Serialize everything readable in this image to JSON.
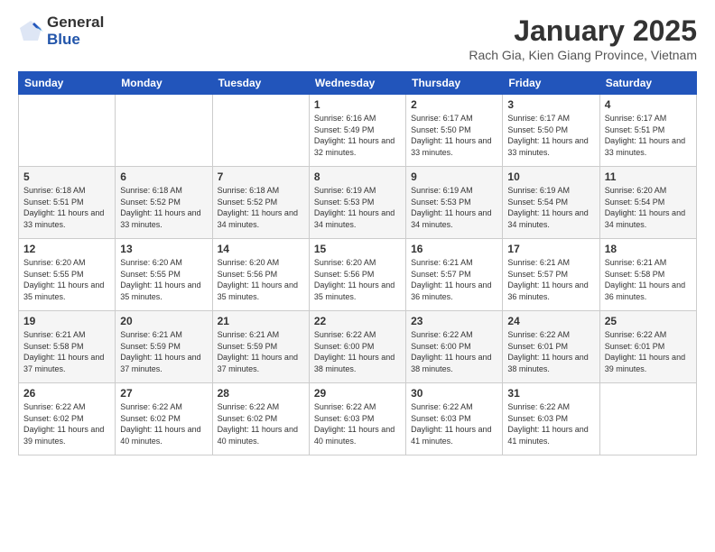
{
  "logo": {
    "general": "General",
    "blue": "Blue"
  },
  "header": {
    "month": "January 2025",
    "location": "Rach Gia, Kien Giang Province, Vietnam"
  },
  "days_of_week": [
    "Sunday",
    "Monday",
    "Tuesday",
    "Wednesday",
    "Thursday",
    "Friday",
    "Saturday"
  ],
  "weeks": [
    [
      {
        "day": "",
        "info": ""
      },
      {
        "day": "",
        "info": ""
      },
      {
        "day": "",
        "info": ""
      },
      {
        "day": "1",
        "info": "Sunrise: 6:16 AM\nSunset: 5:49 PM\nDaylight: 11 hours and 32 minutes."
      },
      {
        "day": "2",
        "info": "Sunrise: 6:17 AM\nSunset: 5:50 PM\nDaylight: 11 hours and 33 minutes."
      },
      {
        "day": "3",
        "info": "Sunrise: 6:17 AM\nSunset: 5:50 PM\nDaylight: 11 hours and 33 minutes."
      },
      {
        "day": "4",
        "info": "Sunrise: 6:17 AM\nSunset: 5:51 PM\nDaylight: 11 hours and 33 minutes."
      }
    ],
    [
      {
        "day": "5",
        "info": "Sunrise: 6:18 AM\nSunset: 5:51 PM\nDaylight: 11 hours and 33 minutes."
      },
      {
        "day": "6",
        "info": "Sunrise: 6:18 AM\nSunset: 5:52 PM\nDaylight: 11 hours and 33 minutes."
      },
      {
        "day": "7",
        "info": "Sunrise: 6:18 AM\nSunset: 5:52 PM\nDaylight: 11 hours and 34 minutes."
      },
      {
        "day": "8",
        "info": "Sunrise: 6:19 AM\nSunset: 5:53 PM\nDaylight: 11 hours and 34 minutes."
      },
      {
        "day": "9",
        "info": "Sunrise: 6:19 AM\nSunset: 5:53 PM\nDaylight: 11 hours and 34 minutes."
      },
      {
        "day": "10",
        "info": "Sunrise: 6:19 AM\nSunset: 5:54 PM\nDaylight: 11 hours and 34 minutes."
      },
      {
        "day": "11",
        "info": "Sunrise: 6:20 AM\nSunset: 5:54 PM\nDaylight: 11 hours and 34 minutes."
      }
    ],
    [
      {
        "day": "12",
        "info": "Sunrise: 6:20 AM\nSunset: 5:55 PM\nDaylight: 11 hours and 35 minutes."
      },
      {
        "day": "13",
        "info": "Sunrise: 6:20 AM\nSunset: 5:55 PM\nDaylight: 11 hours and 35 minutes."
      },
      {
        "day": "14",
        "info": "Sunrise: 6:20 AM\nSunset: 5:56 PM\nDaylight: 11 hours and 35 minutes."
      },
      {
        "day": "15",
        "info": "Sunrise: 6:20 AM\nSunset: 5:56 PM\nDaylight: 11 hours and 35 minutes."
      },
      {
        "day": "16",
        "info": "Sunrise: 6:21 AM\nSunset: 5:57 PM\nDaylight: 11 hours and 36 minutes."
      },
      {
        "day": "17",
        "info": "Sunrise: 6:21 AM\nSunset: 5:57 PM\nDaylight: 11 hours and 36 minutes."
      },
      {
        "day": "18",
        "info": "Sunrise: 6:21 AM\nSunset: 5:58 PM\nDaylight: 11 hours and 36 minutes."
      }
    ],
    [
      {
        "day": "19",
        "info": "Sunrise: 6:21 AM\nSunset: 5:58 PM\nDaylight: 11 hours and 37 minutes."
      },
      {
        "day": "20",
        "info": "Sunrise: 6:21 AM\nSunset: 5:59 PM\nDaylight: 11 hours and 37 minutes."
      },
      {
        "day": "21",
        "info": "Sunrise: 6:21 AM\nSunset: 5:59 PM\nDaylight: 11 hours and 37 minutes."
      },
      {
        "day": "22",
        "info": "Sunrise: 6:22 AM\nSunset: 6:00 PM\nDaylight: 11 hours and 38 minutes."
      },
      {
        "day": "23",
        "info": "Sunrise: 6:22 AM\nSunset: 6:00 PM\nDaylight: 11 hours and 38 minutes."
      },
      {
        "day": "24",
        "info": "Sunrise: 6:22 AM\nSunset: 6:01 PM\nDaylight: 11 hours and 38 minutes."
      },
      {
        "day": "25",
        "info": "Sunrise: 6:22 AM\nSunset: 6:01 PM\nDaylight: 11 hours and 39 minutes."
      }
    ],
    [
      {
        "day": "26",
        "info": "Sunrise: 6:22 AM\nSunset: 6:02 PM\nDaylight: 11 hours and 39 minutes."
      },
      {
        "day": "27",
        "info": "Sunrise: 6:22 AM\nSunset: 6:02 PM\nDaylight: 11 hours and 40 minutes."
      },
      {
        "day": "28",
        "info": "Sunrise: 6:22 AM\nSunset: 6:02 PM\nDaylight: 11 hours and 40 minutes."
      },
      {
        "day": "29",
        "info": "Sunrise: 6:22 AM\nSunset: 6:03 PM\nDaylight: 11 hours and 40 minutes."
      },
      {
        "day": "30",
        "info": "Sunrise: 6:22 AM\nSunset: 6:03 PM\nDaylight: 11 hours and 41 minutes."
      },
      {
        "day": "31",
        "info": "Sunrise: 6:22 AM\nSunset: 6:03 PM\nDaylight: 11 hours and 41 minutes."
      },
      {
        "day": "",
        "info": ""
      }
    ]
  ]
}
